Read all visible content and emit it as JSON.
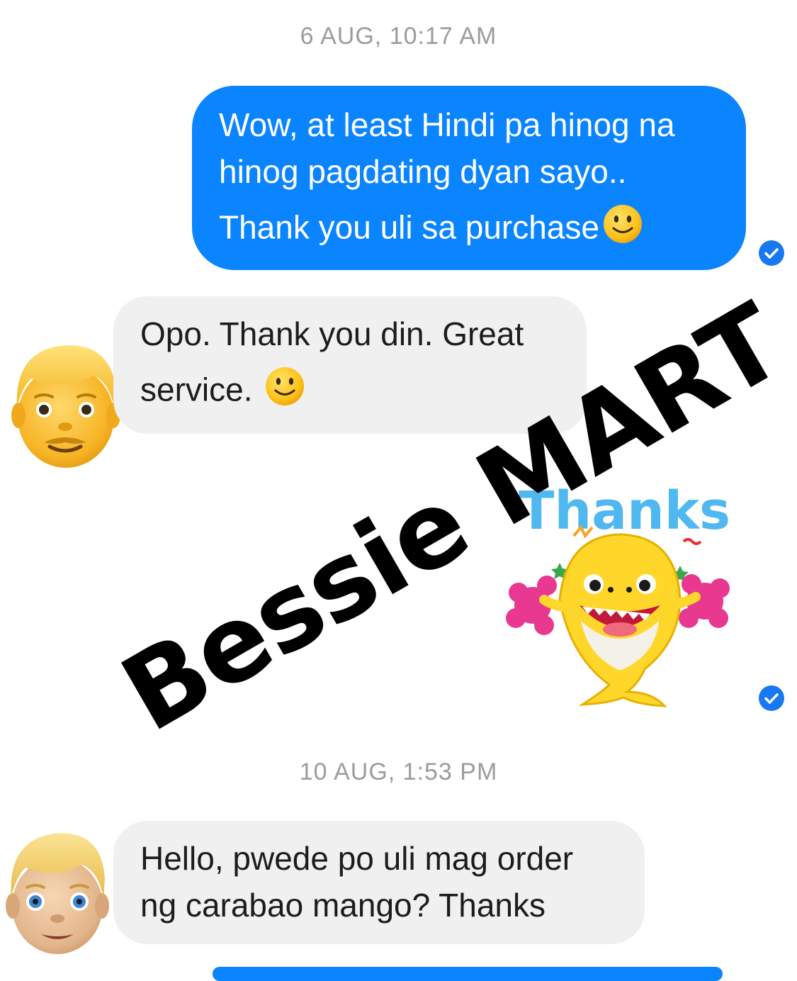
{
  "conversation": {
    "timestamp_1": "6 AUG, 10:17 AM",
    "outgoing_1": {
      "line_1": "Wow, at least Hindi pa hinog na",
      "line_2": "hinog pagdating dyan sayo..",
      "line_3": "Thank you uli sa purchase"
    },
    "incoming_1": {
      "line_1": "Opo. Thank you din. Great",
      "line_2": "service."
    },
    "sticker": {
      "text": "Thanks!",
      "icon": "baby-shark-thanks-sticker"
    },
    "timestamp_2": "10 AUG, 1:53 PM",
    "incoming_2": {
      "line_1": "Hello, pwede po uli mag order",
      "line_2": "ng carabao mango? Thanks"
    }
  },
  "watermark": "Bessie MART",
  "colors": {
    "outgoing_bubble": "#0a84ff",
    "incoming_bubble": "#f0f0f0",
    "read_receipt": "#1877f2",
    "timestamp_text": "#9b9ba1"
  },
  "icons": {
    "avatar_1": "man-blond-emoji-avatar",
    "avatar_2": "man-blond-light-skin-emoji-avatar",
    "read_receipt": "check-circle-icon",
    "smile": "slightly-smiling-face-icon"
  }
}
